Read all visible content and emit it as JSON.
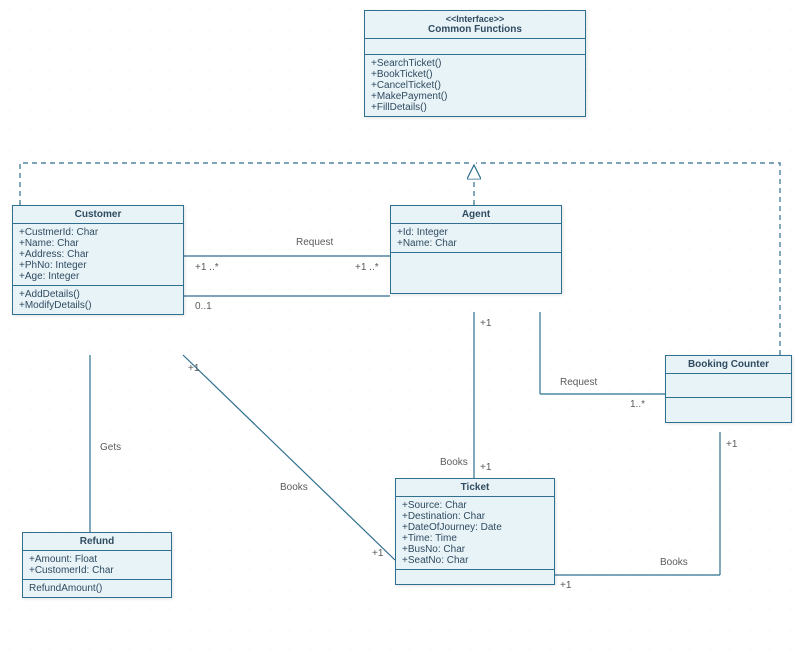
{
  "interface": {
    "stereotype": "<<Interface>>",
    "title": "Common Functions",
    "methods": [
      "+SearchTicket()",
      "+BookTicket()",
      "+CancelTicket()",
      "+MakePayment()",
      "+FillDetails()"
    ]
  },
  "customer": {
    "title": "Customer",
    "attrs": [
      "+CustmerId: Char",
      "+Name: Char",
      "+Address: Char",
      "+PhNo: Integer",
      "+Age: Integer"
    ],
    "methods": [
      "+AddDetails()",
      "+ModifyDetails()"
    ]
  },
  "agent": {
    "title": "Agent",
    "attrs": [
      "+Id: Integer",
      "+Name: Char"
    ]
  },
  "bookingCounter": {
    "title": "Booking Counter"
  },
  "ticket": {
    "title": "Ticket",
    "attrs": [
      "+Source: Char",
      "+Destination: Char",
      "+DateOfJourney: Date",
      "+Time: Time",
      "+BusNo: Char",
      "+SeatNo: Char"
    ]
  },
  "refund": {
    "title": "Refund",
    "attrs": [
      "+Amount: Float",
      "+CustomerId: Char"
    ],
    "methods": [
      "RefundAmount()"
    ]
  },
  "labels": {
    "request": "Request",
    "books": "Books",
    "gets": "Gets",
    "m1star": "+1 ..*",
    "plus1": "+1",
    "mult01": "0..1",
    "m1star2": "1..*"
  }
}
